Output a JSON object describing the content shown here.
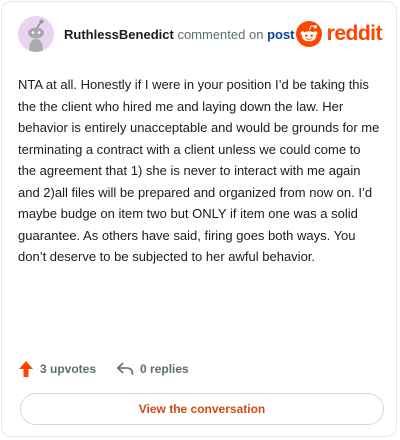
{
  "header": {
    "author": "RuthlessBenedict",
    "commented_on": "commented on",
    "post_link": "post",
    "brand": "reddit"
  },
  "comment": {
    "body": "NTA at all. Honestly if I were in your position I’d be taking this the the client who hired me and laying down the law. Her behavior is entirely unacceptable and would be grounds for me terminating a contract with a client unless we could come to the agreement that 1) she is never to interact with me again and 2)all files will be prepared and organized from now on. I’d maybe budge on item two but ONLY if item one was a solid guarantee. As others have said, firing goes both ways. You don’t deserve to be subjected to her awful behavior."
  },
  "actions": {
    "upvotes": "3 upvotes",
    "replies": "0 replies"
  },
  "cta": {
    "label": "View the conversation"
  },
  "colors": {
    "brand": "#ff4500",
    "upvote": "#ff4500",
    "link": "#0a449b",
    "cta_text": "#d24b12",
    "avatar_bg": "#e9d3f1"
  },
  "icons": {
    "avatar": "snoo-avatar-icon",
    "brand": "reddit-logo-icon",
    "upvote": "upvote-arrow-icon",
    "reply": "reply-arrow-icon"
  }
}
